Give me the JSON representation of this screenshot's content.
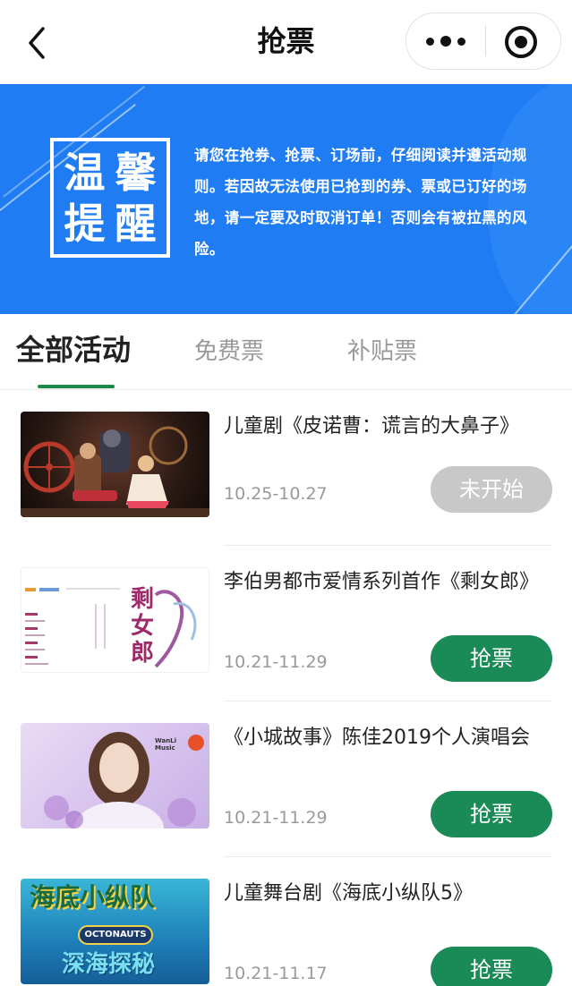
{
  "nav": {
    "title": "抢票"
  },
  "banner": {
    "stamp_chars": [
      "温",
      "馨",
      "提",
      "醒"
    ],
    "text": "请您在抢券、抢票、订场前，仔细阅读并遵活动规则。若因故无法使用已抢到的券、票或已订好的场地，请一定要及时取消订单！否则会有被拉黑的风险。"
  },
  "tabs": [
    {
      "label": "全部活动",
      "active": true
    },
    {
      "label": "免费票",
      "active": false
    },
    {
      "label": "补贴票",
      "active": false
    }
  ],
  "events": [
    {
      "title": "儿童剧《皮诺曹：谎言的大鼻子》",
      "dates": "10.25-10.27",
      "button": "未开始",
      "status": "not-started"
    },
    {
      "title": "李伯男都市爱情系列首作《剩女郎》",
      "dates": "10.21-11.29",
      "button": "抢票",
      "status": "open"
    },
    {
      "title": "《小城故事》陈佳2019个人演唱会",
      "dates": "10.21-11.29",
      "button": "抢票",
      "status": "open"
    },
    {
      "title": "儿童舞台剧《海底小纵队5》",
      "dates": "10.21-11.17",
      "button": "抢票",
      "status": "open"
    }
  ],
  "thumbnails": {
    "poster2_title": "剩女郎",
    "poster3_logo": "WanLi Music",
    "poster4_title": "海底小纵队",
    "poster4_brand": "OCTONAUTS",
    "poster4_subtitle": "深海探秘"
  },
  "colors": {
    "banner_blue": "#1f7cf2",
    "accent_green": "#1a8a56",
    "disabled_gray": "#c8c8c8"
  }
}
